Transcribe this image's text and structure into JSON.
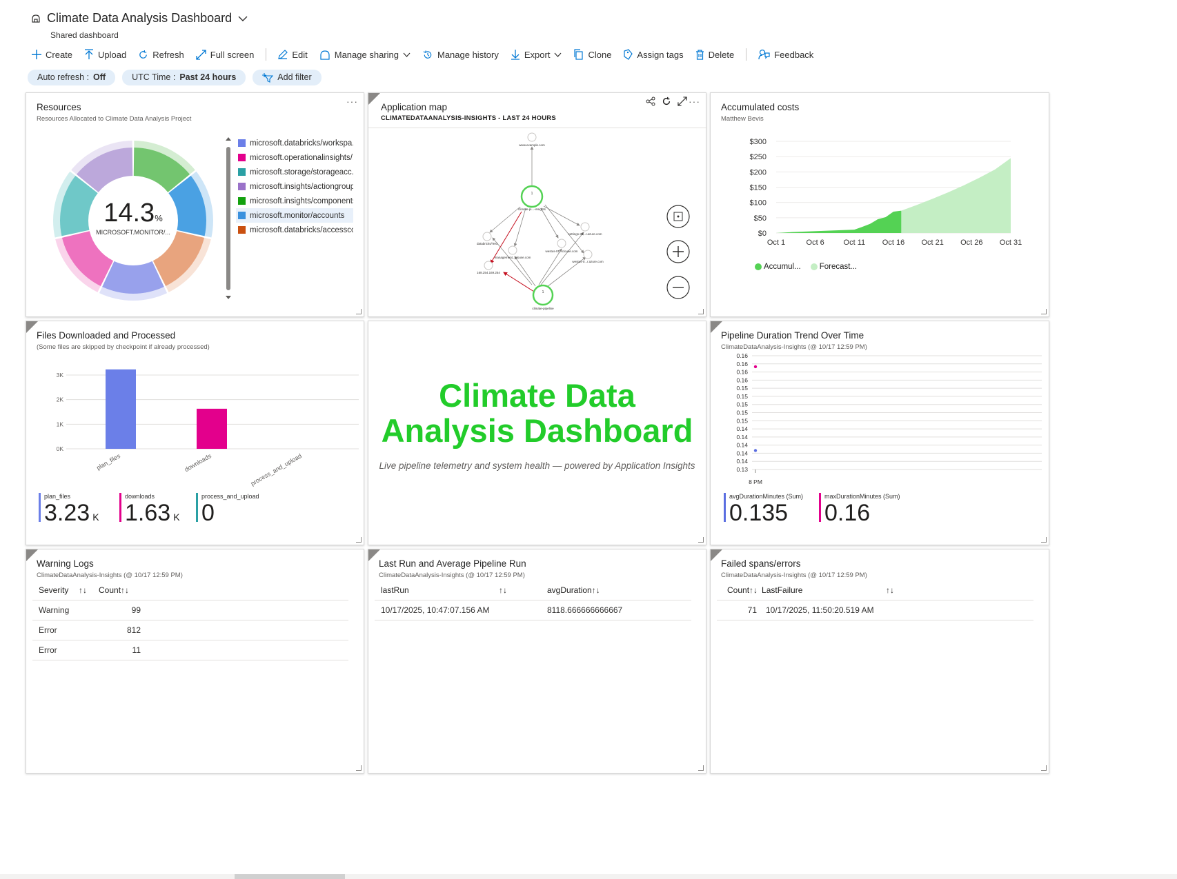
{
  "header": {
    "title": "Climate Data Analysis Dashboard",
    "subtitle": "Shared dashboard"
  },
  "toolbar": {
    "create": "Create",
    "upload": "Upload",
    "refresh": "Refresh",
    "full_screen": "Full screen",
    "edit": "Edit",
    "manage_sharing": "Manage sharing",
    "manage_history": "Manage history",
    "export": "Export",
    "clone": "Clone",
    "assign_tags": "Assign tags",
    "delete": "Delete",
    "feedback": "Feedback"
  },
  "filters": {
    "auto_refresh_label": "Auto refresh :",
    "auto_refresh_value": "Off",
    "utc_label": "UTC Time :",
    "utc_value": "Past 24 hours",
    "add_filter": "Add filter"
  },
  "resources": {
    "title": "Resources",
    "subtitle": "Resources Allocated to Climate Data Analysis Project",
    "center_value": "14.3",
    "center_unit": "%",
    "center_label": "MICROSOFT.MONITOR/...",
    "legend": [
      {
        "label": "microsoft.databricks/workspa...",
        "color": "#6b7fe8"
      },
      {
        "label": "microsoft.operationalinsights/...",
        "color": "#e3008c"
      },
      {
        "label": "microsoft.storage/storageacc...",
        "color": "#2aa0a4"
      },
      {
        "label": "microsoft.insights/actiongroups",
        "color": "#9a72c9"
      },
      {
        "label": "microsoft.insights/components",
        "color": "#13a10e"
      },
      {
        "label": "microsoft.monitor/accounts",
        "color": "#3b91de"
      },
      {
        "label": "microsoft.databricks/accessco...",
        "color": "#ca5010"
      }
    ]
  },
  "app_map": {
    "title": "Application map",
    "subtitle": "CLIMATEDATAANALYSIS-INSIGHTS - LAST 24 HOURS",
    "nodes": [
      "www.example.com",
      "climate-pi...-insights",
      "databricks/Test",
      "management...clouse.com",
      "westus-01...clouse.com",
      "settings-sd...r.azure.com",
      "westus-0...r.azure.com",
      "168.254.169.254",
      "climate-pipeline"
    ]
  },
  "costs": {
    "title": "Accumulated costs",
    "subtitle": "Matthew Bevis",
    "legend_actual": "Accumul...",
    "legend_forecast": "Forecast...",
    "colors": {
      "actual": "#54d254",
      "forecast": "#c4eec4"
    }
  },
  "files": {
    "title": "Files Downloaded and Processed",
    "subtitle": "(Some files are skipped by checkpoint if already processed)",
    "kpis": [
      {
        "label": "plan_files",
        "value": "3.23",
        "unit": "K",
        "color": "#6b7fe8"
      },
      {
        "label": "downloads",
        "value": "1.63",
        "unit": "K",
        "color": "#e3008c"
      },
      {
        "label": "process_and_upload",
        "value": "0",
        "unit": "",
        "color": "#2aa0a4"
      }
    ]
  },
  "hero": {
    "title_line1": "Climate Data",
    "title_line2": "Analysis Dashboard",
    "subtitle": "Live pipeline telemetry and system health — powered by Application Insights"
  },
  "duration": {
    "title": "Pipeline Duration Trend Over Time",
    "subtitle": "ClimateDataAnalysis-Insights (@ 10/17 12:59 PM)",
    "kpis": [
      {
        "label": "avgDurationMinutes (Sum)",
        "value": "0.135",
        "color": "#5b6ee1"
      },
      {
        "label": "maxDurationMinutes (Sum)",
        "value": "0.16",
        "color": "#e3008c"
      }
    ]
  },
  "warning_logs": {
    "title": "Warning Logs",
    "subtitle": "ClimateDataAnalysis-Insights (@ 10/17 12:59 PM)",
    "col_severity": "Severity",
    "col_count": "Count",
    "rows": [
      {
        "severity": "Warning",
        "count": "99"
      },
      {
        "severity": "Error",
        "count": "812"
      },
      {
        "severity": "Error",
        "count": "11"
      }
    ]
  },
  "last_run": {
    "title": "Last Run and Average Pipeline Run",
    "subtitle": "ClimateDataAnalysis-Insights (@ 10/17 12:59 PM)",
    "col_last": "lastRun",
    "col_avg": "avgDuration",
    "rows": [
      {
        "last": "10/17/2025, 10:47:07.156 AM",
        "avg": "8118.666666666667"
      }
    ]
  },
  "failed": {
    "title": "Failed spans/errors",
    "subtitle": "ClimateDataAnalysis-Insights (@ 10/17 12:59 PM)",
    "col_count": "Count",
    "col_last": "LastFailure",
    "rows": [
      {
        "count": "71",
        "last": "10/17/2025, 11:50:20.519 AM"
      }
    ]
  },
  "chart_data": [
    {
      "type": "pie",
      "title": "Resources",
      "categories": [
        "microsoft.databricks/workspa...",
        "microsoft.operationalinsights/...",
        "microsoft.storage/storageacc...",
        "microsoft.insights/actiongroups",
        "microsoft.insights/components",
        "microsoft.monitor/accounts",
        "microsoft.databricks/accessco..."
      ],
      "values": [
        14.3,
        14.3,
        14.3,
        14.3,
        14.3,
        14.3,
        14.3
      ],
      "colors": [
        "#8d97ea",
        "#ec63b8",
        "#5fc2c2",
        "#b59fd7",
        "#64bf5f",
        "#4aa1e3",
        "#e59a70"
      ],
      "order_clockwise_from_top": [
        4,
        5,
        6,
        0,
        1,
        2,
        3
      ]
    },
    {
      "type": "area",
      "title": "Accumulated costs",
      "x_ticks": [
        "Oct 1",
        "Oct 6",
        "Oct 11",
        "Oct 16",
        "Oct 21",
        "Oct 26",
        "Oct 31"
      ],
      "y_ticks": [
        "$0",
        "$50",
        "$100",
        "$150",
        "$200",
        "$250",
        "$300"
      ],
      "ylim": [
        0,
        300
      ],
      "series": [
        {
          "name": "Accumul...",
          "x": [
            1,
            3,
            5,
            7,
            9,
            11,
            12,
            13,
            14,
            15,
            16,
            17
          ],
          "y": [
            0,
            3,
            5,
            7,
            9,
            11,
            20,
            30,
            45,
            52,
            70,
            73
          ]
        },
        {
          "name": "Forecast...",
          "x": [
            17,
            19,
            21,
            23,
            25,
            27,
            29,
            31
          ],
          "y": [
            73,
            92,
            112,
            133,
            156,
            181,
            208,
            245
          ]
        }
      ]
    },
    {
      "type": "bar",
      "title": "Files Downloaded and Processed",
      "categories": [
        "plan_files",
        "downloads",
        "process_and_upload"
      ],
      "values": [
        3230,
        1630,
        0
      ],
      "colors": [
        "#6b7fe8",
        "#e3008c",
        "#2aa0a4"
      ],
      "y_ticks": [
        "0K",
        "1K",
        "2K",
        "3K"
      ],
      "ylim": [
        0,
        3000
      ]
    },
    {
      "type": "scatter",
      "title": "Pipeline Duration Trend Over Time",
      "y_ticks": [
        "0.16",
        "0.16",
        "0.16",
        "0.16",
        "0.15",
        "0.15",
        "0.15",
        "0.15",
        "0.15",
        "0.14",
        "0.14",
        "0.14",
        "0.14",
        "0.14",
        "0.13"
      ],
      "x_ticks": [
        "8 PM"
      ],
      "ylim": [
        0.13,
        0.16
      ],
      "series": [
        {
          "name": "maxDurationMinutes (Sum)",
          "color": "#e3008c",
          "values": [
            0.16
          ]
        },
        {
          "name": "avgDurationMinutes (Sum)",
          "color": "#5b6ee1",
          "values": [
            0.135
          ]
        }
      ]
    }
  ]
}
